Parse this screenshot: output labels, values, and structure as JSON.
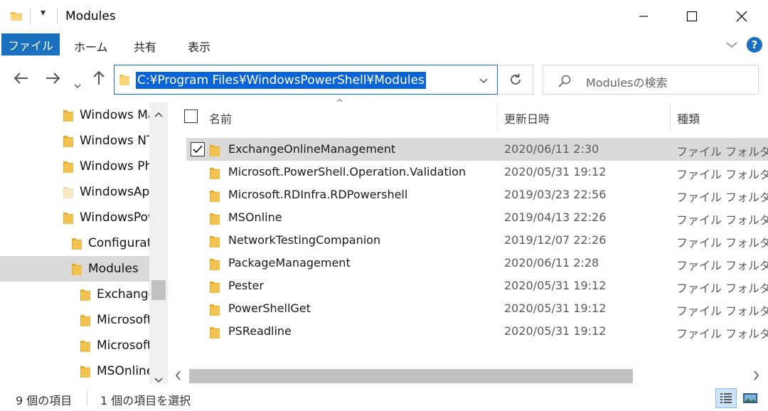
{
  "window": {
    "title": "Modules",
    "quick_access": "▾"
  },
  "ribbon": {
    "tabs": [
      {
        "label": "ファイル"
      },
      {
        "label": "ホーム"
      },
      {
        "label": "共有"
      },
      {
        "label": "表示"
      }
    ]
  },
  "address": {
    "path": "C:¥Program Files¥WindowsPowerShell¥Modules"
  },
  "search": {
    "placeholder": "Modulesの検索"
  },
  "nav_tree": [
    {
      "label": "Windows Mail"
    },
    {
      "label": "Windows NT"
    },
    {
      "label": "Windows Photo Viewer"
    },
    {
      "label": "WindowsApps"
    },
    {
      "label": "WindowsPowerShell"
    },
    {
      "label": "Configuration"
    },
    {
      "label": "Modules"
    },
    {
      "label": "ExchangeOnlineManagement"
    },
    {
      "label": "Microsoft.PowerShell.Operation.Validation"
    },
    {
      "label": "Microsoft.RDInfra.RDPowershell"
    },
    {
      "label": "MSOnline"
    }
  ],
  "columns": {
    "name": "名前",
    "date": "更新日時",
    "type": "種類",
    "sort_indicator": "^"
  },
  "files": [
    {
      "name": "ExchangeOnlineManagement",
      "date": "2020/06/11 2:30",
      "type": "ファイル フォルダー",
      "selected": true
    },
    {
      "name": "Microsoft.PowerShell.Operation.Validation",
      "date": "2020/05/31 19:12",
      "type": "ファイル フォルダー"
    },
    {
      "name": "Microsoft.RDInfra.RDPowershell",
      "date": "2019/03/23 22:56",
      "type": "ファイル フォルダー"
    },
    {
      "name": "MSOnline",
      "date": "2019/04/13 22:26",
      "type": "ファイル フォルダー"
    },
    {
      "name": "NetworkTestingCompanion",
      "date": "2019/12/07 22:26",
      "type": "ファイル フォルダー"
    },
    {
      "name": "PackageManagement",
      "date": "2020/06/11 2:28",
      "type": "ファイル フォルダー"
    },
    {
      "name": "Pester",
      "date": "2020/05/31 19:12",
      "type": "ファイル フォルダー"
    },
    {
      "name": "PowerShellGet",
      "date": "2020/05/31 19:12",
      "type": "ファイル フォルダー"
    },
    {
      "name": "PSReadline",
      "date": "2020/05/31 19:12",
      "type": "ファイル フォルダー"
    }
  ],
  "status": {
    "item_count": "9 個の項目",
    "selected_count": "1 個の項目を選択"
  },
  "colors": {
    "accent": "#1a6fbf",
    "folder": "#f2c14e",
    "selection": "#d9d9d9",
    "address_highlight": "#0a64d6"
  }
}
